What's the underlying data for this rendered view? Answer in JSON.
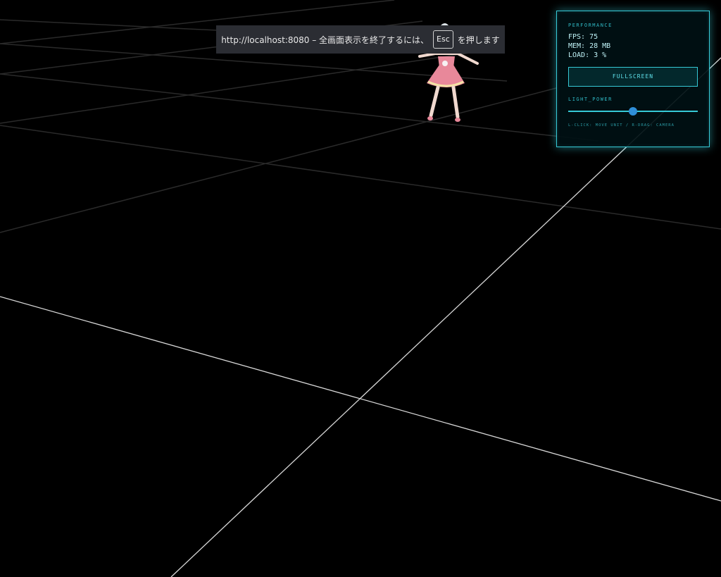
{
  "banner": {
    "text_before_key": "http://localhost:8080 – 全画面表示を終了するには、",
    "key": "Esc",
    "text_after_key": "を押します"
  },
  "hud": {
    "performance_title": "PERFORMANCE",
    "fps": "FPS: 75",
    "mem": "MEM: 28 MB",
    "load": "LOAD: 3 %",
    "fullscreen_label": "FULLSCREEN",
    "light_power_title": "LIGHT_POWER",
    "light_power_value": 0.5,
    "hint": "L-CLICK: MOVE UNIT / R-DRAG: CAMERA",
    "accent_color": "#36c9d6",
    "thumb_color": "#2f8fd8"
  },
  "scene": {
    "background_color": "#000000",
    "grid_color": "#2a2a2a",
    "axis_color": "#d8d8d8",
    "character": {
      "dress_color": "#e8889a",
      "skin_color": "#f1d9cf"
    }
  }
}
